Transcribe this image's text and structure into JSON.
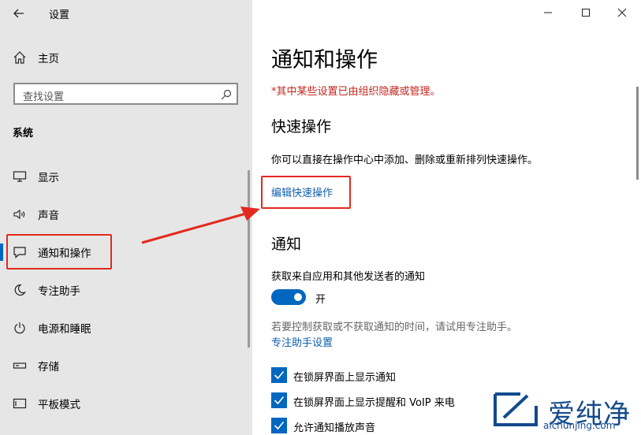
{
  "titlebar": {
    "app_title": "设置"
  },
  "sidebar": {
    "home": "主页",
    "search_placeholder": "查找设置",
    "section": "系统",
    "items": [
      {
        "label": "显示",
        "icon": "monitor-icon"
      },
      {
        "label": "声音",
        "icon": "speaker-icon"
      },
      {
        "label": "通知和操作",
        "icon": "notification-icon"
      },
      {
        "label": "专注助手",
        "icon": "moon-icon"
      },
      {
        "label": "电源和睡眠",
        "icon": "power-icon"
      },
      {
        "label": "存储",
        "icon": "storage-icon"
      },
      {
        "label": "平板模式",
        "icon": "tablet-icon"
      }
    ],
    "selected_index": 2
  },
  "main": {
    "title": "通知和操作",
    "warning": "*其中某些设置已由组织隐藏或管理。",
    "quick_actions": {
      "heading": "快速操作",
      "description": "你可以直接在操作中心中添加、删除或重新排列快速操作。",
      "edit_link": "编辑快速操作"
    },
    "notifications": {
      "heading": "通知",
      "get_notifications_label": "获取来自应用和其他发送者的通知",
      "toggle_state": "开",
      "focus_hint": "若要控制获取或不获取通知的时间，请试用专注助手。",
      "focus_link": "专注助手设置",
      "checkboxes": [
        {
          "label": "在锁屏界面上显示通知",
          "checked": true
        },
        {
          "label": "在锁屏界面上显示提醒和 VoIP 来电",
          "checked": true
        },
        {
          "label": "允许通知播放声音",
          "checked": true
        }
      ]
    }
  },
  "watermark": {
    "brand": "爱纯净",
    "url": "aichunjing.com"
  },
  "colors": {
    "accent": "#0067c0",
    "annotation": "#e32a1e",
    "warning": "#c4261d",
    "link": "#0f5fae"
  }
}
